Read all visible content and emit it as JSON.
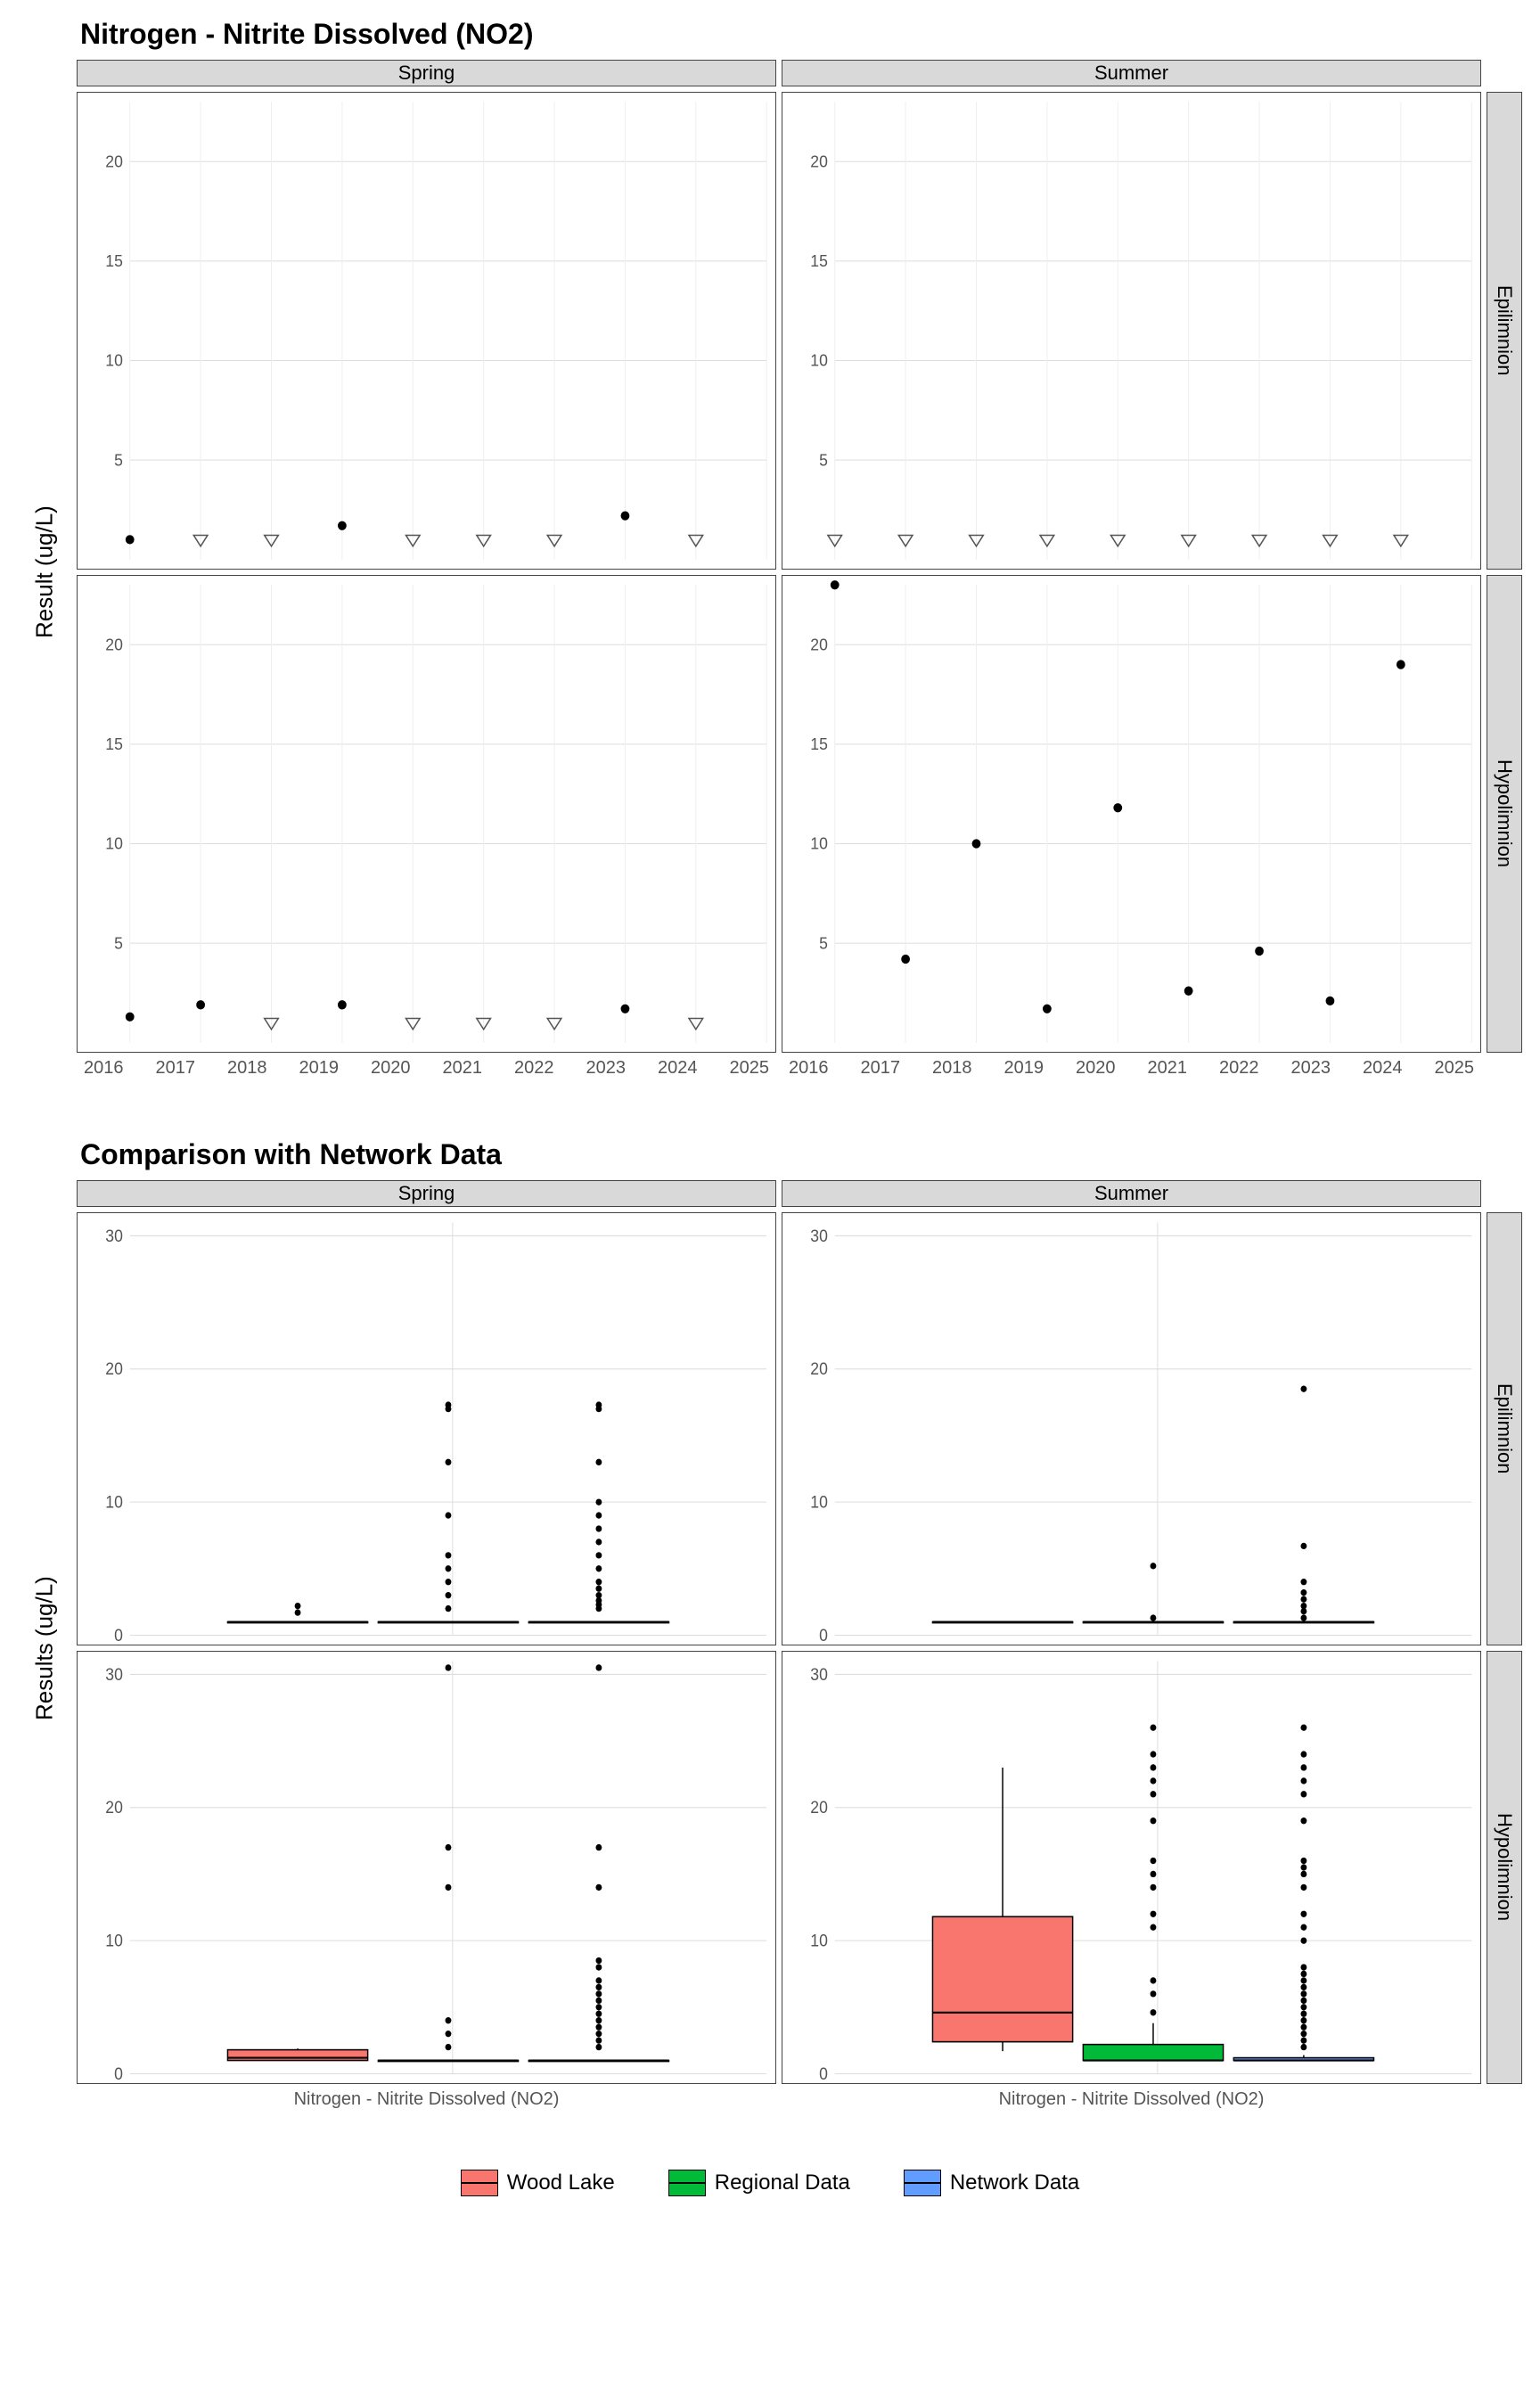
{
  "chart1": {
    "title": "Nitrogen - Nitrite Dissolved (NO2)",
    "ylabel": "Result (ug/L)",
    "col_facets": [
      "Spring",
      "Summer"
    ],
    "row_facets": [
      "Epilimnion",
      "Hypolimnion"
    ],
    "x_ticks": [
      "2016",
      "2017",
      "2018",
      "2019",
      "2020",
      "2021",
      "2022",
      "2023",
      "2024",
      "2025"
    ]
  },
  "chart2": {
    "title": "Comparison with Network Data",
    "ylabel": "Results (ug/L)",
    "col_facets": [
      "Spring",
      "Summer"
    ],
    "row_facets": [
      "Epilimnion",
      "Hypolimnion"
    ],
    "x_category": "Nitrogen - Nitrite Dissolved (NO2)"
  },
  "legend": {
    "items": [
      "Wood Lake",
      "Regional Data",
      "Network Data"
    ]
  },
  "chart_data": [
    {
      "type": "scatter",
      "title": "Nitrogen - Nitrite Dissolved (NO2)",
      "ylabel": "Result (ug/L)",
      "xlabel": "",
      "ylim": [
        0,
        23
      ],
      "xlim": [
        2016,
        2025
      ],
      "x_ticks": [
        2016,
        2017,
        2018,
        2019,
        2020,
        2021,
        2022,
        2023,
        2024,
        2025
      ],
      "y_ticks": [
        5,
        10,
        15,
        20
      ],
      "facets_cols": [
        "Spring",
        "Summer"
      ],
      "facets_rows": [
        "Epilimnion",
        "Hypolimnion"
      ],
      "note": "open_triangle marker = below detection limit",
      "panels": {
        "Spring_Epilimnion": [
          {
            "year": 2016,
            "value": 1.0,
            "marker": "dot"
          },
          {
            "year": 2017,
            "value": 1.0,
            "marker": "open_triangle"
          },
          {
            "year": 2018,
            "value": 1.0,
            "marker": "open_triangle"
          },
          {
            "year": 2019,
            "value": 1.7,
            "marker": "dot"
          },
          {
            "year": 2020,
            "value": 1.0,
            "marker": "open_triangle"
          },
          {
            "year": 2021,
            "value": 1.0,
            "marker": "open_triangle"
          },
          {
            "year": 2022,
            "value": 1.0,
            "marker": "open_triangle"
          },
          {
            "year": 2023,
            "value": 2.2,
            "marker": "dot"
          },
          {
            "year": 2024,
            "value": 1.0,
            "marker": "open_triangle"
          }
        ],
        "Summer_Epilimnion": [
          {
            "year": 2016,
            "value": 1.0,
            "marker": "open_triangle"
          },
          {
            "year": 2017,
            "value": 1.0,
            "marker": "open_triangle"
          },
          {
            "year": 2018,
            "value": 1.0,
            "marker": "open_triangle"
          },
          {
            "year": 2019,
            "value": 1.0,
            "marker": "open_triangle"
          },
          {
            "year": 2020,
            "value": 1.0,
            "marker": "open_triangle"
          },
          {
            "year": 2021,
            "value": 1.0,
            "marker": "open_triangle"
          },
          {
            "year": 2022,
            "value": 1.0,
            "marker": "open_triangle"
          },
          {
            "year": 2023,
            "value": 1.0,
            "marker": "open_triangle"
          },
          {
            "year": 2024,
            "value": 1.0,
            "marker": "open_triangle"
          }
        ],
        "Spring_Hypolimnion": [
          {
            "year": 2016,
            "value": 1.3,
            "marker": "dot"
          },
          {
            "year": 2017,
            "value": 1.9,
            "marker": "dot"
          },
          {
            "year": 2018,
            "value": 1.0,
            "marker": "open_triangle"
          },
          {
            "year": 2019,
            "value": 1.9,
            "marker": "dot"
          },
          {
            "year": 2020,
            "value": 1.0,
            "marker": "open_triangle"
          },
          {
            "year": 2021,
            "value": 1.0,
            "marker": "open_triangle"
          },
          {
            "year": 2022,
            "value": 1.0,
            "marker": "open_triangle"
          },
          {
            "year": 2023,
            "value": 1.7,
            "marker": "dot"
          },
          {
            "year": 2024,
            "value": 1.0,
            "marker": "open_triangle"
          }
        ],
        "Summer_Hypolimnion": [
          {
            "year": 2016,
            "value": 23.0,
            "marker": "dot"
          },
          {
            "year": 2017,
            "value": 4.2,
            "marker": "dot"
          },
          {
            "year": 2018,
            "value": 10.0,
            "marker": "dot"
          },
          {
            "year": 2019,
            "value": 1.7,
            "marker": "dot"
          },
          {
            "year": 2020,
            "value": 11.8,
            "marker": "dot"
          },
          {
            "year": 2021,
            "value": 2.6,
            "marker": "dot"
          },
          {
            "year": 2022,
            "value": 4.6,
            "marker": "dot"
          },
          {
            "year": 2023,
            "value": 2.1,
            "marker": "dot"
          },
          {
            "year": 2024,
            "value": 19.0,
            "marker": "dot"
          }
        ]
      }
    },
    {
      "type": "boxplot",
      "title": "Comparison with Network Data",
      "ylabel": "Results (ug/L)",
      "xlabel": "Nitrogen - Nitrite Dissolved (NO2)",
      "ylim": [
        0,
        31
      ],
      "y_ticks": [
        0,
        10,
        20,
        30
      ],
      "facets_cols": [
        "Spring",
        "Summer"
      ],
      "facets_rows": [
        "Epilimnion",
        "Hypolimnion"
      ],
      "series_colors": {
        "Wood Lake": "#F8766D",
        "Regional Data": "#00BA38",
        "Network Data": "#619CFF"
      },
      "panels": {
        "Spring_Epilimnion": {
          "Wood Lake": {
            "q1": 1.0,
            "median": 1.0,
            "q3": 1.0,
            "whisker_low": 1.0,
            "whisker_high": 1.0,
            "outliers": [
              2.2,
              1.7
            ]
          },
          "Regional Data": {
            "q1": 1.0,
            "median": 1.0,
            "q3": 1.0,
            "whisker_low": 1.0,
            "whisker_high": 1.0,
            "outliers": [
              2,
              3,
              4,
              5,
              6,
              9,
              13,
              17,
              17.3
            ]
          },
          "Network Data": {
            "q1": 1.0,
            "median": 1.0,
            "q3": 1.0,
            "whisker_low": 1.0,
            "whisker_high": 1.0,
            "outliers": [
              2,
              2.3,
              2.6,
              3,
              3.5,
              4,
              5,
              6,
              7,
              8,
              9,
              10,
              13,
              17,
              17.3
            ]
          }
        },
        "Summer_Epilimnion": {
          "Wood Lake": {
            "q1": 1.0,
            "median": 1.0,
            "q3": 1.0,
            "whisker_low": 1.0,
            "whisker_high": 1.0,
            "outliers": []
          },
          "Regional Data": {
            "q1": 1.0,
            "median": 1.0,
            "q3": 1.0,
            "whisker_low": 1.0,
            "whisker_high": 1.0,
            "outliers": [
              1.3,
              5.2
            ]
          },
          "Network Data": {
            "q1": 1.0,
            "median": 1.0,
            "q3": 1.0,
            "whisker_low": 1.0,
            "whisker_high": 1.0,
            "outliers": [
              1.3,
              1.8,
              2.2,
              2.7,
              3.2,
              4.0,
              6.7,
              18.5
            ]
          }
        },
        "Spring_Hypolimnion": {
          "Wood Lake": {
            "q1": 1.0,
            "median": 1.2,
            "q3": 1.8,
            "whisker_low": 1.0,
            "whisker_high": 1.9,
            "outliers": []
          },
          "Regional Data": {
            "q1": 1.0,
            "median": 1.0,
            "q3": 1.0,
            "whisker_low": 1.0,
            "whisker_high": 1.0,
            "outliers": [
              2,
              3,
              4,
              14,
              17,
              30.5
            ]
          },
          "Network Data": {
            "q1": 1.0,
            "median": 1.0,
            "q3": 1.0,
            "whisker_low": 1.0,
            "whisker_high": 1.0,
            "outliers": [
              2,
              2.5,
              3,
              3.5,
              4,
              4.5,
              5,
              5.5,
              6,
              6.5,
              7,
              8,
              8.5,
              14,
              17,
              30.5
            ]
          }
        },
        "Summer_Hypolimnion": {
          "Wood Lake": {
            "q1": 2.4,
            "median": 4.6,
            "q3": 11.8,
            "whisker_low": 1.7,
            "whisker_high": 23.0,
            "outliers": []
          },
          "Regional Data": {
            "q1": 1.0,
            "median": 1.0,
            "q3": 2.2,
            "whisker_low": 1.0,
            "whisker_high": 3.8,
            "outliers": [
              4.6,
              6,
              7,
              11,
              12,
              14,
              15,
              16,
              19,
              21,
              22,
              23,
              24,
              26
            ]
          },
          "Network Data": {
            "q1": 1.0,
            "median": 1.0,
            "q3": 1.2,
            "whisker_low": 1.0,
            "whisker_high": 1.4,
            "outliers": [
              2,
              2.5,
              3,
              3.5,
              4,
              4.5,
              5,
              5.5,
              6,
              6.5,
              7,
              7.5,
              8,
              10,
              11,
              12,
              14,
              15,
              15.5,
              16,
              19,
              21,
              22,
              23,
              24,
              26
            ]
          }
        }
      }
    }
  ]
}
